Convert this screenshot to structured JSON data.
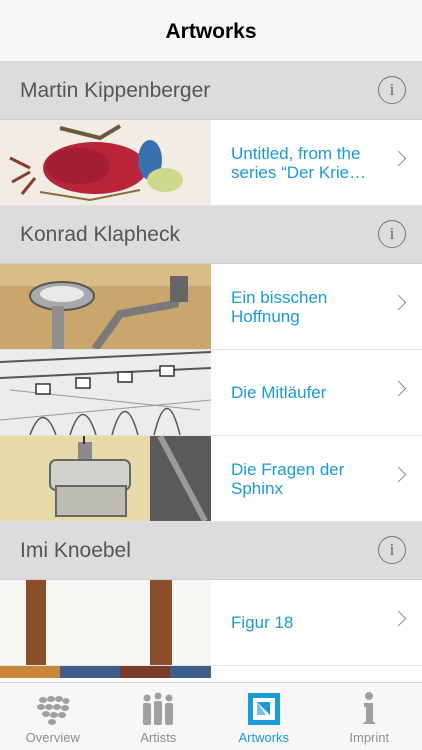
{
  "navbar": {
    "title": "Artworks"
  },
  "sections": [
    {
      "artist": "Martin Kippenberger",
      "artworks": [
        {
          "title": "Untitled, from the series “Der Krie…"
        }
      ]
    },
    {
      "artist": "Konrad Klapheck",
      "artworks": [
        {
          "title": "Ein bisschen Hoffnung"
        },
        {
          "title": "Die Mitläufer"
        },
        {
          "title": "Die Fragen der Sphinx"
        }
      ]
    },
    {
      "artist": "Imi Knoebel",
      "artworks": [
        {
          "title": "Figur 18"
        }
      ]
    }
  ],
  "info_glyph": "i",
  "tabbar": {
    "tabs": [
      {
        "label": "Overview",
        "icon": "overview-icon"
      },
      {
        "label": "Artists",
        "icon": "artists-icon"
      },
      {
        "label": "Artworks",
        "icon": "artworks-icon",
        "active": true
      },
      {
        "label": "Imprint",
        "icon": "imprint-icon"
      }
    ]
  },
  "colors": {
    "accent": "#1a9ad6",
    "section_bg": "#dcdcdc",
    "bar_bg": "#f7f7f7"
  }
}
